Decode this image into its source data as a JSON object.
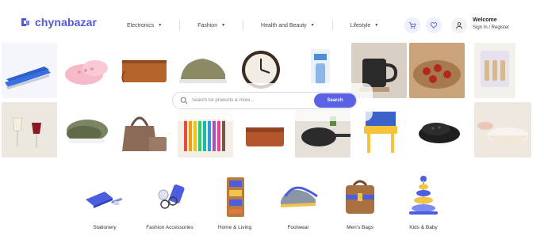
{
  "brand": {
    "name": "chynabazar",
    "color": "#4f5bd5"
  },
  "nav": [
    {
      "label": "Electronics"
    },
    {
      "label": "Fashion"
    },
    {
      "label": "Health and Beauty"
    },
    {
      "label": "Lifestyle"
    }
  ],
  "header": {
    "cart_icon": "cart-icon",
    "wishlist_icon": "heart-icon",
    "user_icon": "user-icon",
    "welcome": "Welcome",
    "signin": "Sign In / Register"
  },
  "search": {
    "placeholder": "Search for products & more...",
    "button_label": "Search",
    "accent": "#5a61e3"
  },
  "products_row1": [
    "stapler",
    "pink-clogs",
    "leather-pouch",
    "olive-sneakers",
    "wall-clock",
    "nasal-spray",
    "black-mug",
    "tea-set",
    "roll-on-bottles"
  ],
  "products_row2": [
    "wine-glasses",
    "green-clogs",
    "tote-bag-set",
    "color-pencils",
    "brown-clutch",
    "frying-pan",
    "kids-chair",
    "black-sandals",
    "bowl-set"
  ],
  "categories": [
    {
      "label": "Stationery"
    },
    {
      "label": "Fashion Accessories"
    },
    {
      "label": "Home & Living"
    },
    {
      "label": "Footwear"
    },
    {
      "label": "Men's Bags"
    },
    {
      "label": "Kids & Baby"
    }
  ]
}
